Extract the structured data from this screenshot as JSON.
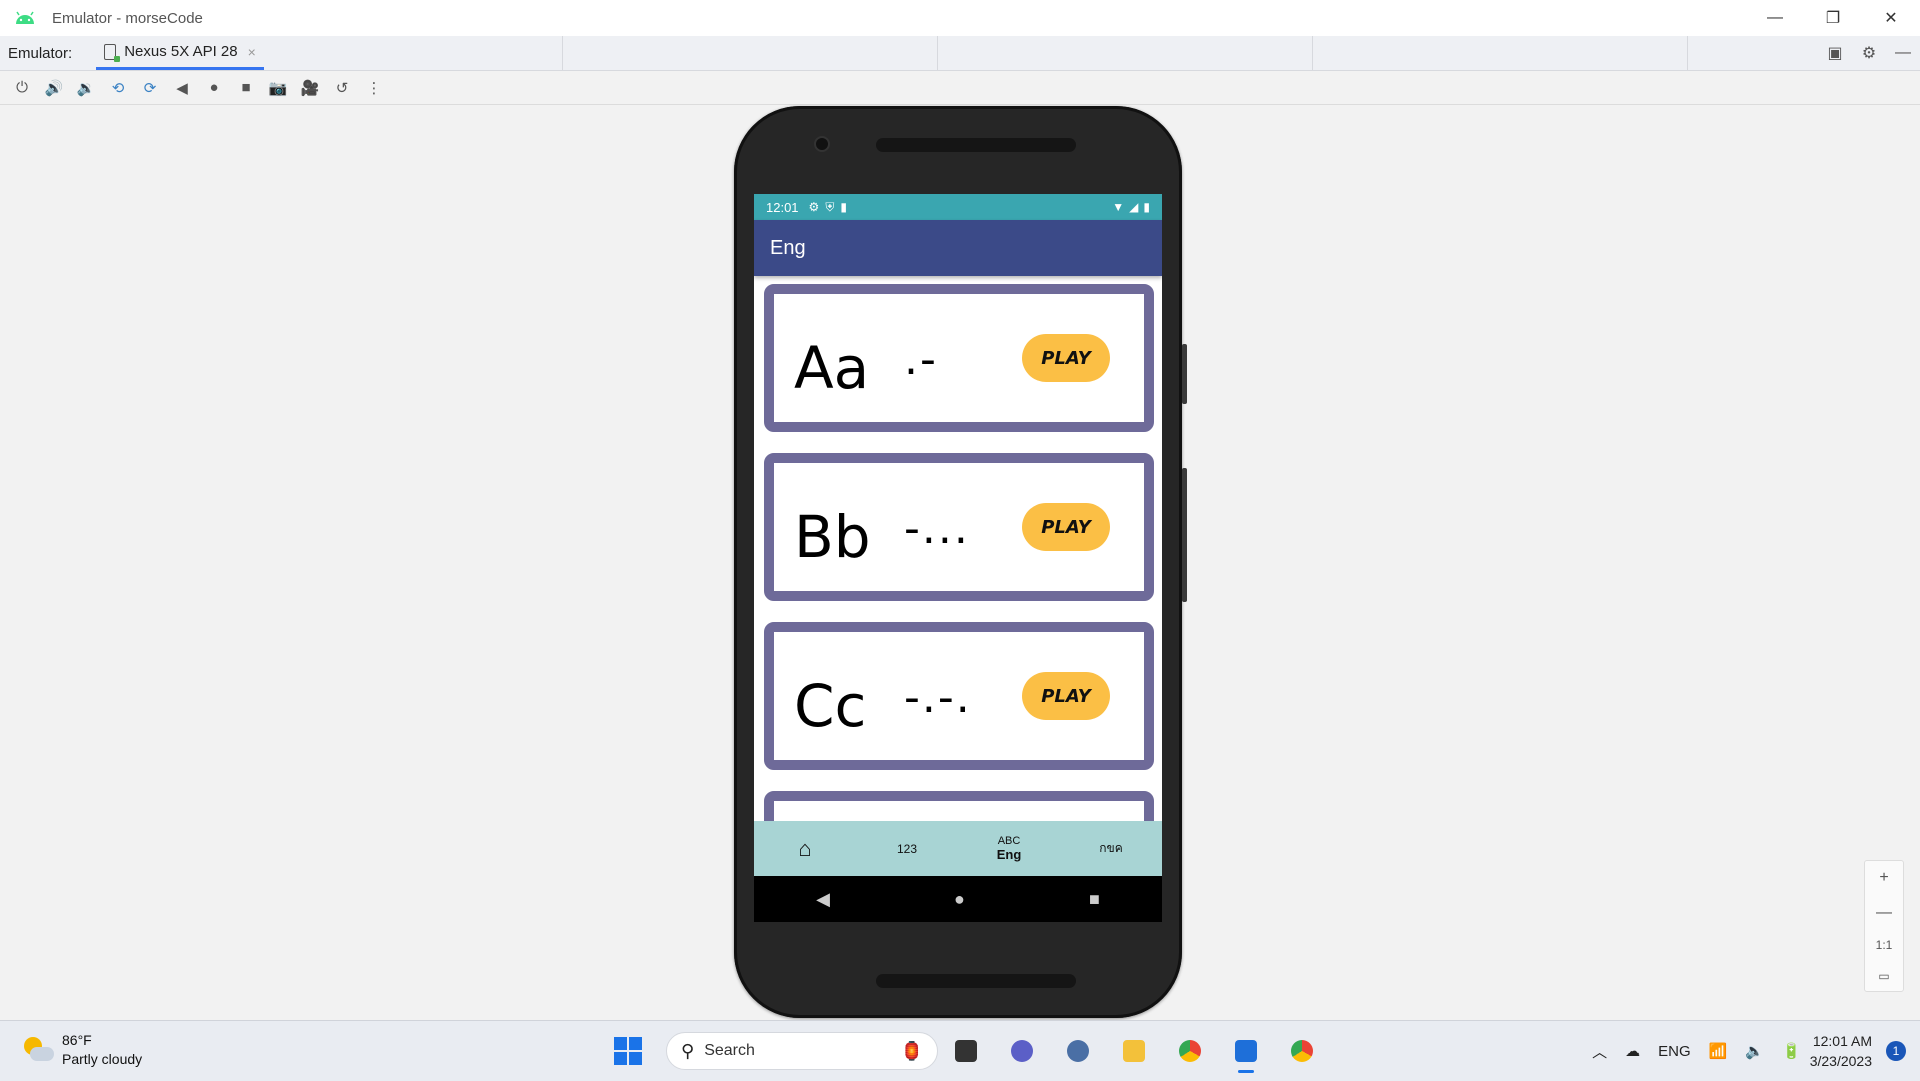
{
  "window": {
    "title": "Emulator - morseCode",
    "controls": {
      "minimize": "—",
      "restore": "❐",
      "close": "✕"
    }
  },
  "tabbar": {
    "label": "Emulator:",
    "tab_label": "Nexus 5X API 28",
    "tab_close": "×"
  },
  "toolbar": {
    "icons": [
      "power-icon",
      "volume-up-icon",
      "volume-down-icon",
      "rotate-left-icon",
      "rotate-right-icon",
      "back-icon",
      "home-icon",
      "overview-icon",
      "screenshot-icon",
      "screen-record-icon",
      "snapshot-icon",
      "more-icon"
    ]
  },
  "phone": {
    "status_time": "12:01",
    "app_title": "Eng",
    "cards": [
      {
        "letter": "Aa",
        "morse": ".-",
        "button": "PLAY"
      },
      {
        "letter": "Bb",
        "morse": "-...",
        "button": "PLAY"
      },
      {
        "letter": "Cc",
        "morse": "-.-.",
        "button": "PLAY"
      }
    ],
    "bottom_nav": {
      "home": "⌂",
      "numbers": "123",
      "abc_top": "ABC",
      "abc_label": "Eng",
      "thai": "กขค"
    }
  },
  "zoom": {
    "plus": "+",
    "minus": "—",
    "ratio": "1:1"
  },
  "taskbar": {
    "weather_temp": "86°F",
    "weather_desc": "Partly cloudy",
    "search_placeholder": "Search",
    "language": "ENG",
    "time": "12:01 AM",
    "date": "3/23/2023",
    "notification_count": "1"
  }
}
